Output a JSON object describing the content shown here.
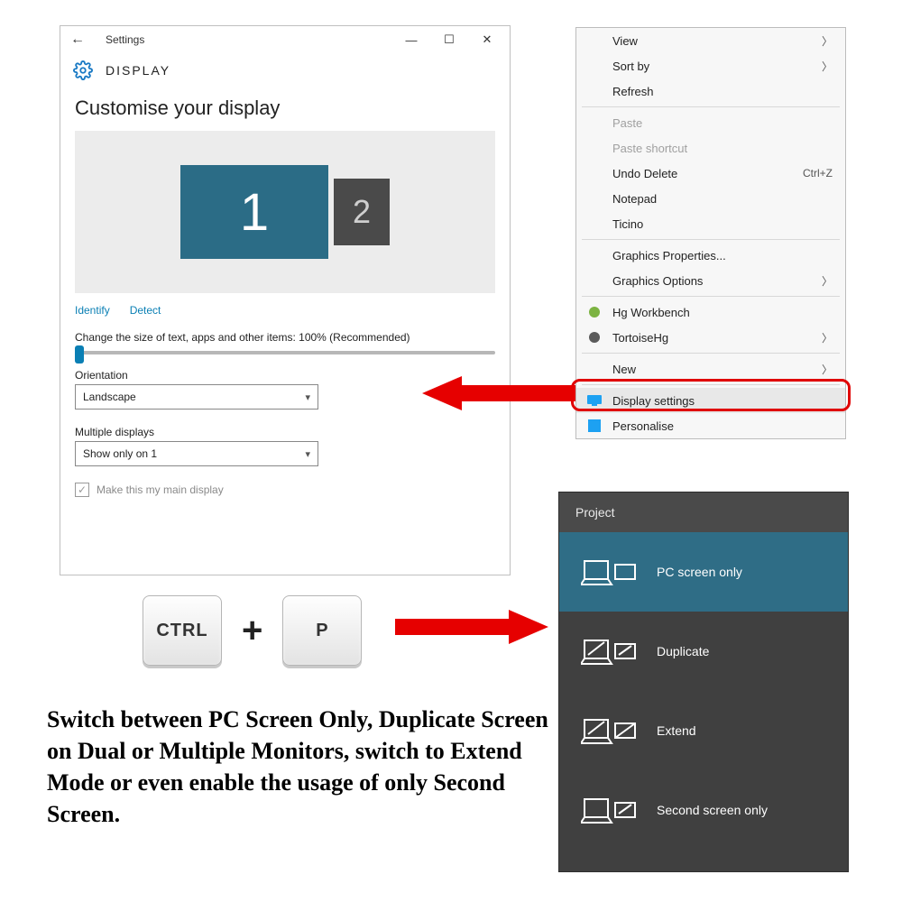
{
  "settings": {
    "window_title": "Settings",
    "header": "DISPLAY",
    "section_title": "Customise your display",
    "monitor1": "1",
    "monitor2": "2",
    "link_identify": "Identify",
    "link_detect": "Detect",
    "scale_label": "Change the size of text, apps and other items: 100% (Recommended)",
    "orientation_label": "Orientation",
    "orientation_value": "Landscape",
    "multiple_label": "Multiple displays",
    "multiple_value": "Show only on 1",
    "main_display_label": "Make this my main display"
  },
  "context_menu": {
    "items": [
      {
        "label": "View",
        "arrow": true
      },
      {
        "label": "Sort by",
        "arrow": true
      },
      {
        "label": "Refresh"
      },
      {
        "sep": true
      },
      {
        "label": "Paste",
        "disabled": true
      },
      {
        "label": "Paste shortcut",
        "disabled": true
      },
      {
        "label": "Undo Delete",
        "shortcut": "Ctrl+Z"
      },
      {
        "label": "Notepad"
      },
      {
        "label": "Ticino"
      },
      {
        "sep": true
      },
      {
        "label": "Graphics Properties..."
      },
      {
        "label": "Graphics Options",
        "arrow": true
      },
      {
        "sep": true
      },
      {
        "label": "Hg Workbench",
        "icon": "hg"
      },
      {
        "label": "TortoiseHg",
        "icon": "tortoise",
        "arrow": true
      },
      {
        "sep": true
      },
      {
        "label": "New",
        "arrow": true
      },
      {
        "sep": true
      },
      {
        "label": "Display settings",
        "icon": "display",
        "highlight": true
      },
      {
        "label": "Personalise",
        "icon": "personalise"
      }
    ]
  },
  "keys": {
    "k1": "CTRL",
    "plus": "+",
    "k2": "P"
  },
  "project": {
    "title": "Project",
    "items": [
      {
        "label": "PC screen only",
        "selected": true
      },
      {
        "label": "Duplicate"
      },
      {
        "label": "Extend"
      },
      {
        "label": "Second screen only"
      }
    ]
  },
  "instruction": "Switch between PC Screen Only, Duplicate Screen on Dual or Multiple Monitors, switch to Extend Mode or even enable the usage of only Second Screen."
}
